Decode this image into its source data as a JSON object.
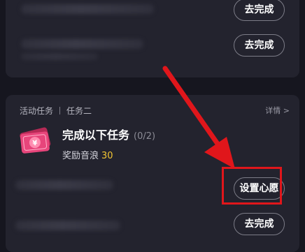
{
  "top_card": {
    "task1_button": "去完成",
    "task2_button": "去完成"
  },
  "bottom_card": {
    "header": {
      "section_label": "活动任务",
      "task_label": "任务二",
      "detail_link": "详情 >"
    },
    "task": {
      "title": "完成以下任务",
      "progress": "(0/2)",
      "reward_label": "奖励音浪",
      "reward_value": "30"
    },
    "subtask1_button": "设置心愿",
    "subtask2_button": "去完成"
  },
  "icons": {
    "ticket": "ticket-icon",
    "arrow": "red-arrow-annotation"
  },
  "colors": {
    "background": "#16161f",
    "card": "#23232e",
    "reward_accent": "#f3c533",
    "annotation_red": "#e0161b",
    "ticket_pink": "#e7457b"
  }
}
